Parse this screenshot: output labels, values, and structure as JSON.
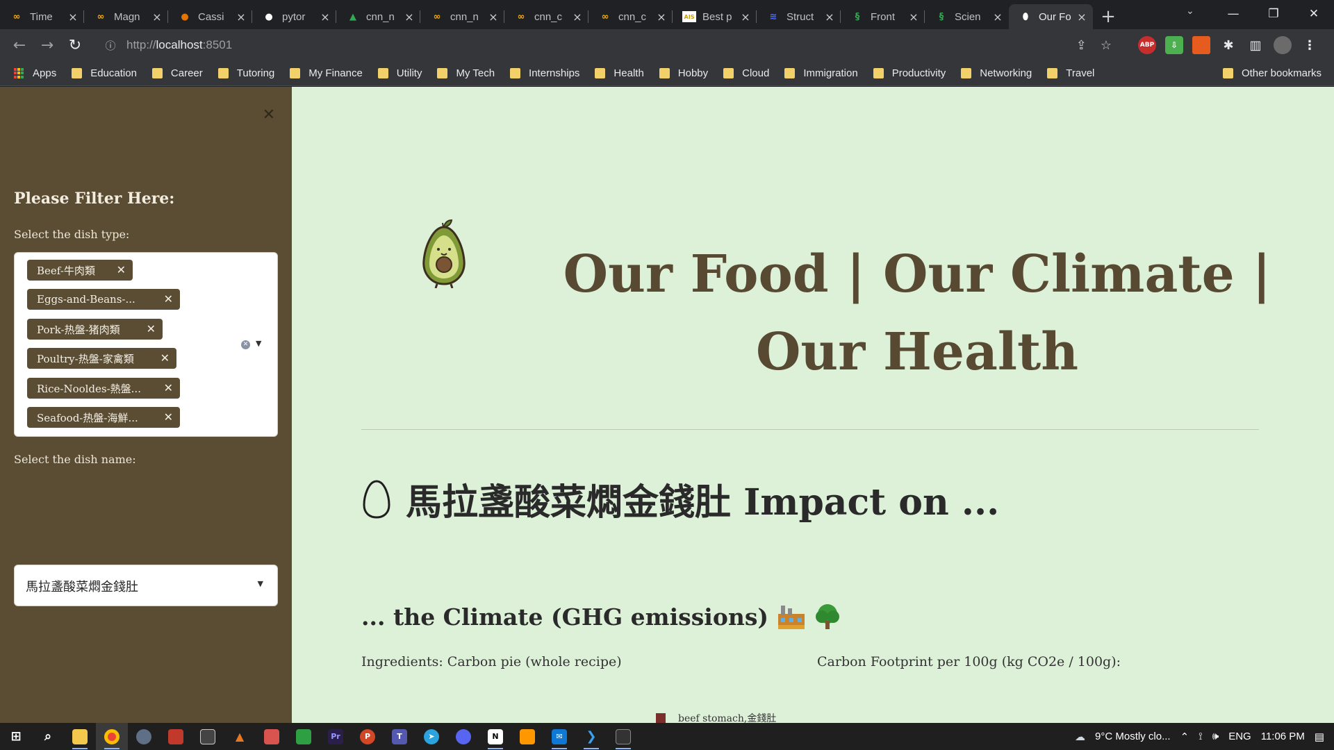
{
  "browser": {
    "tabs": [
      {
        "title": "Time",
        "icon": "colab-icon",
        "color": "#f9ab00"
      },
      {
        "title": "Magn",
        "icon": "colab-icon",
        "color": "#f9ab00"
      },
      {
        "title": "Cassi",
        "icon": "cassini-icon",
        "color": "#e37400"
      },
      {
        "title": "pytor",
        "icon": "github-icon",
        "color": "#ffffff"
      },
      {
        "title": "cnn_n",
        "icon": "google-drive-icon",
        "color": "#34a853"
      },
      {
        "title": "cnn_n",
        "icon": "colab-icon",
        "color": "#f9ab00"
      },
      {
        "title": "cnn_c",
        "icon": "colab-icon",
        "color": "#f9ab00"
      },
      {
        "title": "cnn_c",
        "icon": "colab-icon",
        "color": "#f9ab00"
      },
      {
        "title": "Best p",
        "icon": "ais-icon",
        "color": "#ffffff"
      },
      {
        "title": "Struct",
        "icon": "structure-icon",
        "color": "#4c6ef5"
      },
      {
        "title": "Front",
        "icon": "frontiers-icon",
        "color": "#34a853"
      },
      {
        "title": "Scien",
        "icon": "science-icon",
        "color": "#34a853"
      },
      {
        "title": "Our Fo",
        "icon": "egg-icon",
        "color": "#ffffff"
      }
    ],
    "address": {
      "scheme": "http://",
      "host": "localhost",
      "port": ":8501"
    },
    "bookmarks": [
      "Apps",
      "Education",
      "Career",
      "Tutoring",
      "My Finance",
      "Utility",
      "My Tech",
      "Internships",
      "Health",
      "Hobby",
      "Cloud",
      "Immigration",
      "Productivity",
      "Networking",
      "Travel"
    ],
    "other_bookmarks": "Other bookmarks"
  },
  "sidebar": {
    "title": "Please Filter Here:",
    "dish_type_label": "Select the dish type:",
    "dish_types": [
      "Beef-牛肉類",
      "Eggs-and-Beans-...",
      "Pork-热盤-猪肉類",
      "Poultry-热盤-家禽類",
      "Rice-Nooldes-熱盤...",
      "Seafood-热盤-海鮮..."
    ],
    "dish_name_label": "Select the dish name:",
    "dish_name_value": "馬拉盞酸菜燜金錢肚"
  },
  "main": {
    "hero_title": "Our Food | Our Climate | Our Health",
    "impact_heading": "馬拉盞酸菜燜金錢肚 Impact on ...",
    "climate_heading": "... the Climate (GHG emissions)",
    "ingredients_label": "Ingredients: Carbon pie (whole recipe)",
    "footprint_label": "Carbon Footprint per 100g (kg CO2e / 100g):",
    "legend_item": "beef stomach,金錢肚",
    "legend_color": "#7a2f2a",
    "accent_brown": "#584a32",
    "background_green": "#ddf0d8"
  },
  "taskbar": {
    "weather": "9°C  Mostly clo...",
    "language": "ENG",
    "time": "11:06 PM"
  }
}
